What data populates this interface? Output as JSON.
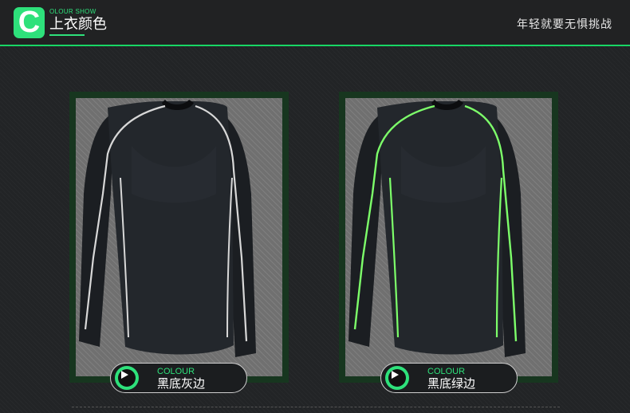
{
  "header": {
    "logo_letter": "C",
    "logo_small_text": "OLOUR SHOW",
    "title": "上衣颜色",
    "slogan": "年轻就要无惧挑战"
  },
  "products": [
    {
      "label_en": "COLOUR",
      "label_cn": "黑底灰边",
      "stitch_color": "#d8d8d8"
    },
    {
      "label_en": "COLOUR",
      "label_cn": "黑底绿边",
      "stitch_color": "#7dff6a"
    }
  ],
  "colors": {
    "accent": "#2ee17b",
    "frame": "#17361f",
    "shirt": "#1b1e22"
  }
}
